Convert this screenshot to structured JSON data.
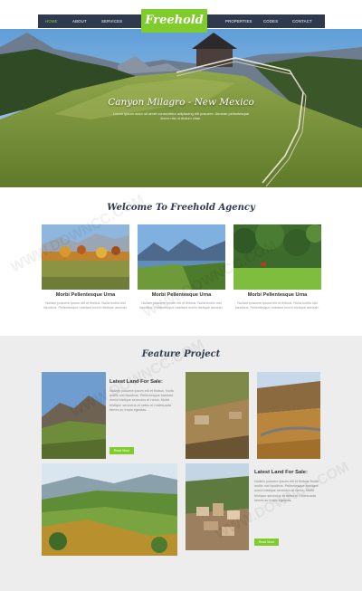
{
  "nav": {
    "left_items": [
      "HOME",
      "ABOUT",
      "SERVICES"
    ],
    "right_items": [
      "PROPERTIES",
      "CODES",
      "CONTACT"
    ],
    "active": "HOME",
    "logo": "Freehold"
  },
  "hero": {
    "title": "Canyon Milagro - New Mexico",
    "text": "Lorem ipsum dolor sit amet consectetur adipiscing elit posuere. Aenean pellentesque libero nisi ut dictum vitae."
  },
  "welcome": {
    "title": "Welcome To Freehold Agency",
    "cards": [
      {
        "title": "Morbi Pellentesque Urna",
        "text": "Nullam posuere ipsum elit et finibus. Nulla mollis nisl faucibus. Pellentesque habitant morbi tristique aenean."
      },
      {
        "title": "Morbi Pellentesque Urna",
        "text": "Nullam posuere ipsum elit et finibus. Nulla mollis nisl faucibus. Pellentesque habitant morbi tristique aenean."
      },
      {
        "title": "Morbi Pellentesque Urna",
        "text": "Nullam posuere ipsum elit et finibus. Nulla mollis nisl faucibus. Pellentesque habitant morbi tristique aenean."
      }
    ]
  },
  "feature": {
    "title": "Feature Project",
    "items": [
      {
        "title": "Latest Land For Sale:",
        "text": "Nullam posuere ipsum elit et finibus. Nulla mollis nisl faucibus. Pellentesque habitant morbi tristique senectus et netus. Morbi tristique senectus et netus et malesuada fames ac turpis egestas.",
        "button": "Read More"
      },
      {
        "title": "Latest Land For Sale:",
        "text": "Nullam posuere ipsum elit et finibus. Nulla mollis nisl faucibus. Pellentesque habitant morbi tristique senectus et netus. Morbi tristique senectus et netus et malesuada fames ac turpis egestas.",
        "button": "Read More"
      }
    ]
  },
  "watermark": "WWW.DOWNCC.COM",
  "colors": {
    "accent": "#7fcc2c",
    "nav_bg": "#2f3a4e",
    "feature_bg": "#ededed"
  },
  "icons": []
}
